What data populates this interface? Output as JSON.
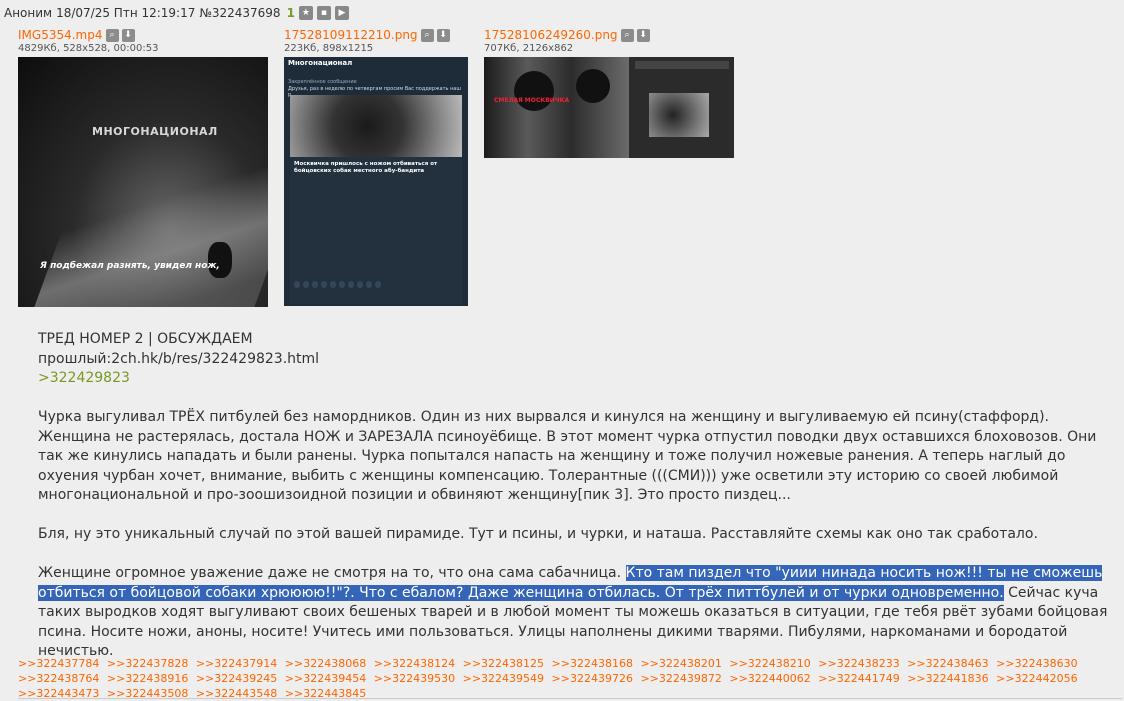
{
  "header": {
    "name": "Аноним",
    "datetime": "18/07/25 Птн 12:19:17",
    "post_number": "№322437698",
    "reply_count": "1"
  },
  "files": [
    {
      "name": "IMG5354.mp4",
      "meta": "4829Кб, 528x528, 00:00:53"
    },
    {
      "name": "17528109112210.png",
      "meta": "223Кб, 898x1215"
    },
    {
      "name": "17528106249260.png",
      "meta": "707Кб, 2126x862"
    }
  ],
  "thumb1": {
    "watermark": "МНОГОНАЦИОНАЛ",
    "caption": "Я подбежал разнять, увидел нож,"
  },
  "thumb2": {
    "channel": "Многонационал",
    "pinned_label": "Закреплённое сообщение",
    "pinned_text": "Друзья, раз в неделю по четвергам просим Вас поддержать наш р...",
    "title": "Москвичка пришлось с ножом отбиваться от бойцовских собак местного абу-бандита"
  },
  "thumb3": {
    "red_label": "СМЕЛАЯ МОСКВИЧКА"
  },
  "body": {
    "line1": "ТРЕД НОМЕР 2 | ОБСУЖДАЕМ",
    "line2": "прошлый:2ch.hk/b/res/322429823.html",
    "quote": ">322429823",
    "para1": "Чурка выгуливал ТРЁХ питбулей без намордников. Один из них вырвался и кинулся на женщину и выгуливаемую ей псину(стаффорд). Женщина не растерялась, достала НОЖ и ЗАРЕЗАЛА псиноуёбище. В этот момент чурка отпустил поводки двух оставшихся блоховозов. Они так же кинулись нападать и были ранены. Чурка попытался напасть на женщину и тоже получил ножевые ранения. А теперь наглый до охуения чурбан хочет, внимание, выбить с женщины компенсацию. Толерантные (((СМИ))) уже осветили эту историю со своей любимой многонациональной и про-зоошизоидной позиции и обвиняют женщину[пик 3]. Это просто пиздец...",
    "para2": "Бля, ну это уникальный случай по этой вашей пирамиде. Тут и псины, и чурки, и наташа. Расставляйте схемы как оно так сработало.",
    "para3_start": "Женщине огромное уважение даже не смотря на то, что она сама сабачница. ",
    "para3_selected": "Кто там пиздел что \"уиии нинада носить нож!!! ты не сможешь отбиться от бойцовой собаки хрюююю!!\"?. Что с ебалом? Даже женщина отбилась. От трёх питтбулей и от чурки одновременно.",
    "para3_end": " Сейчас куча таких выродков ходят выгуливают своих бешеных тварей и в любой момент ты можешь оказаться в ситуации, где тебя рвёт зубами бойцовая псина. Носите ножи, аноны, носите! Учитесь ими пользоваться. Улицы наполнены дикими тварями. Пибулями, наркоманами и бородатой нечистью."
  },
  "replies": [
    ">>322437784",
    ">>322437828",
    ">>322437914",
    ">>322438068",
    ">>322438124",
    ">>322438125",
    ">>322438168",
    ">>322438201",
    ">>322438210",
    ">>322438233",
    ">>322438463",
    ">>322438630",
    ">>322438764",
    ">>322438916",
    ">>322439245",
    ">>322439454",
    ">>322439530",
    ">>322439549",
    ">>322439726",
    ">>322439872",
    ">>322440062",
    ">>322441749",
    ">>322441836",
    ">>322442056",
    ">>322443473",
    ">>322443508",
    ">>322443548",
    ">>322443845"
  ]
}
